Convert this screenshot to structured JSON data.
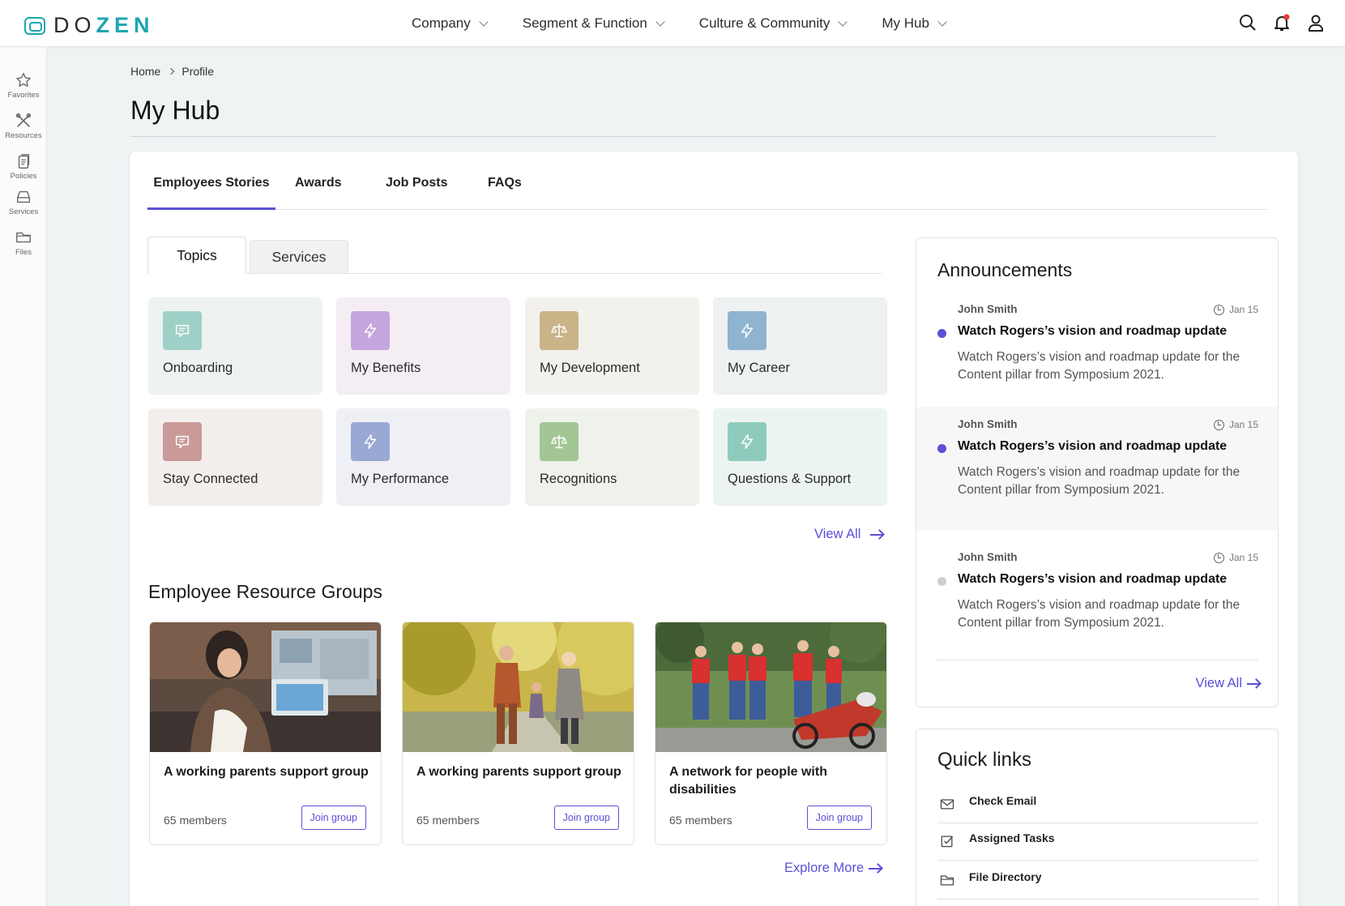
{
  "brand": {
    "name_dark": "DO",
    "name_accent": "ZEN",
    "accent": "#1ba6b0"
  },
  "nav": {
    "items": [
      {
        "label": "Company"
      },
      {
        "label": "Segment & Function"
      },
      {
        "label": "Culture & Community"
      },
      {
        "label": "My Hub"
      }
    ]
  },
  "rail": {
    "items": [
      {
        "label": "Favorites",
        "icon": "star-icon"
      },
      {
        "label": "Resources",
        "icon": "tools-icon"
      },
      {
        "label": "Policies",
        "icon": "documents-icon"
      },
      {
        "label": "Services",
        "icon": "tray-icon"
      },
      {
        "label": "Files",
        "icon": "folder-icon"
      }
    ]
  },
  "breadcrumb": {
    "home": "Home",
    "current": "Profile"
  },
  "page": {
    "title": "My Hub"
  },
  "tabs": [
    {
      "label": "Employees Stories",
      "active": true
    },
    {
      "label": "Awards"
    },
    {
      "label": "Job Posts"
    },
    {
      "label": "FAQs"
    }
  ],
  "subtabs": {
    "active": "Topics",
    "inactive": "Services"
  },
  "topics": [
    {
      "label": "Onboarding",
      "icon": "chat-icon",
      "bg": "#eef2f1",
      "icon_bg": "#9fd0c7"
    },
    {
      "label": "My Benefits",
      "icon": "bolt-icon",
      "bg": "#f4eef4",
      "icon_bg": "#c5a5dd"
    },
    {
      "label": "My Development",
      "icon": "scale-icon",
      "bg": "#f2f1ec",
      "icon_bg": "#c8b487"
    },
    {
      "label": "My Career",
      "icon": "bolt-icon",
      "bg": "#eef1f2",
      "icon_bg": "#8fb4cf"
    },
    {
      "label": "Stay Connected",
      "icon": "chat-icon",
      "bg": "#f3eeec",
      "icon_bg": "#c99a98"
    },
    {
      "label": "My Performance",
      "icon": "bolt-icon",
      "bg": "#eef0f5",
      "icon_bg": "#9aa9d4"
    },
    {
      "label": "Recognitions",
      "icon": "scale-icon",
      "bg": "#eef2ea",
      "icon_bg": "#a3c695"
    },
    {
      "label": "Questions & Support",
      "icon": "bolt-icon",
      "bg": "#ecf4f1",
      "icon_bg": "#8fcbbd"
    }
  ],
  "topics_view_all": "View All",
  "erg": {
    "title": "Employee Resource Groups",
    "cards": [
      {
        "name": "A working parents support group",
        "members": "65 members",
        "button": "Join group"
      },
      {
        "name": "A working parents support group",
        "members": "65 members",
        "button": "Join group"
      },
      {
        "name": "A network for people with disabilities",
        "members": "65 members",
        "button": "Join group"
      }
    ],
    "explore": "Explore More"
  },
  "announcements": {
    "title": "Announcements",
    "items": [
      {
        "author": "John Smith",
        "date": "Jan 15",
        "headline": "Watch Rogers’s vision and roadmap update",
        "body": "Watch Rogers’s vision and roadmap update for the Content pillar from Symposium 2021.",
        "unread": true
      },
      {
        "author": "John Smith",
        "date": "Jan 15",
        "headline": "Watch Rogers’s vision and roadmap update",
        "body": "Watch Rogers’s vision and roadmap update for the Content pillar from Symposium 2021.",
        "unread": true
      },
      {
        "author": "John Smith",
        "date": "Jan 15",
        "headline": "Watch Rogers’s vision and roadmap update",
        "body": "Watch Rogers’s vision and roadmap update for the Content pillar from Symposium 2021.",
        "unread": false
      }
    ],
    "view_all": "View All",
    "unread_color": "#5b4fd6",
    "read_color": "#cfcfcf"
  },
  "quick_links": {
    "title": "Quick links",
    "items": [
      {
        "label": "Check Email",
        "icon": "mail-icon"
      },
      {
        "label": "Assigned Tasks",
        "icon": "checkbox-icon"
      },
      {
        "label": "File Directory",
        "icon": "folder-icon"
      }
    ]
  },
  "colors": {
    "accent": "#5b4fd6",
    "notification_dot": "#e53935"
  }
}
